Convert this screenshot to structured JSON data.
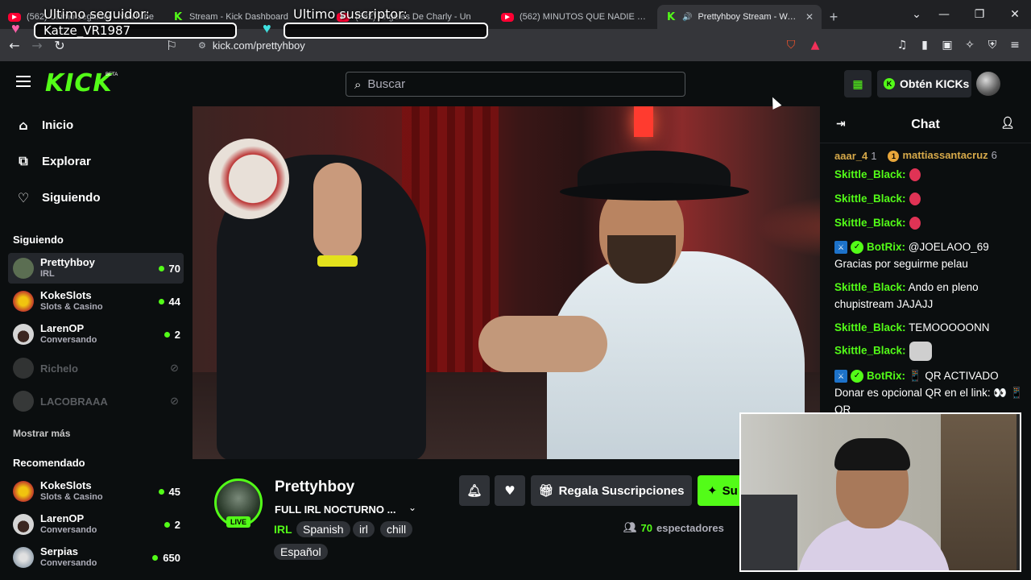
{
  "browser": {
    "tabs": [
      {
        "title": "(562) Ultimo seguidor - YouTube",
        "favicon": "youtube-icon",
        "active": false
      },
      {
        "title": "Stream - Kick Dashboard",
        "favicon": "kick-icon",
        "active": false
      },
      {
        "title": "(562) Angeles De Charly - Un",
        "favicon": "youtube-icon",
        "active": false
      },
      {
        "title": "(562) MINUTOS QUE NADIE POD",
        "favicon": "youtube-icon",
        "active": false
      },
      {
        "title": "Prettyhboy Stream - Watch",
        "favicon": "kick-icon",
        "active": true
      }
    ],
    "url": "kick.com/prettyhboy",
    "brave_badge": "10"
  },
  "overlay": {
    "follower_label": "Ultimo seguidor:",
    "follower_value": "Katze_VR1987",
    "subscriber_label": "Ultimo suscriptor:",
    "subscriber_value": ""
  },
  "header": {
    "logo": "KICK",
    "logo_badge": "BETA",
    "search_placeholder": "Buscar",
    "get_kicks": "Obtén KICKs"
  },
  "sidebar": {
    "nav": [
      {
        "label": "Inicio",
        "icon": "home-icon"
      },
      {
        "label": "Explorar",
        "icon": "compass-icon"
      },
      {
        "label": "Siguiendo",
        "icon": "heart-icon"
      }
    ],
    "following_title": "Siguiendo",
    "following": [
      {
        "name": "Prettyhboy",
        "category": "IRL",
        "viewers": "70",
        "live": true,
        "color": "#5b6e52"
      },
      {
        "name": "KokeSlots",
        "category": "Slots & Casino",
        "viewers": "44",
        "live": true,
        "color": "#c0392b"
      },
      {
        "name": "LarenOP",
        "category": "Conversando",
        "viewers": "2",
        "live": true,
        "color": "#d5d5d5"
      },
      {
        "name": "Richelo",
        "category": "",
        "viewers": "",
        "live": false,
        "color": "#777777"
      },
      {
        "name": "LACOBRAAA",
        "category": "",
        "viewers": "",
        "live": false,
        "color": "#888888"
      }
    ],
    "show_more": "Mostrar más",
    "recommended_title": "Recomendado",
    "recommended": [
      {
        "name": "KokeSlots",
        "category": "Slots & Casino",
        "viewers": "45",
        "color": "#c0392b"
      },
      {
        "name": "LarenOP",
        "category": "Conversando",
        "viewers": "2",
        "color": "#d5d5d5"
      },
      {
        "name": "Serpias",
        "category": "Conversando",
        "viewers": "650",
        "color": "#9aa7b3"
      }
    ]
  },
  "stream": {
    "streamer": "Prettyhboy",
    "title": "FULL IRL NOCTURNO ...",
    "category": "IRL",
    "tags": [
      "Spanish",
      "irl",
      "chill",
      "Español"
    ],
    "live_badge": "LIVE",
    "gift_subs": "Regala Suscripciones",
    "subscribe": "Su",
    "viewer_count": "70",
    "viewers_label": "espectadores"
  },
  "chat": {
    "title": "Chat",
    "gifters": [
      {
        "name": "aaar_4",
        "count": "1"
      },
      {
        "name": "mattiassantacruz",
        "count": "6"
      }
    ],
    "messages": [
      {
        "user": "Skittle_Black:",
        "text": "",
        "emote": "red"
      },
      {
        "user": "Skittle_Black:",
        "text": "",
        "emote": "red"
      },
      {
        "user": "Skittle_Black:",
        "text": "",
        "emote": "red"
      },
      {
        "user": "BotRix:",
        "text": "@JOELAOO_69 Gracias por seguirme pelau",
        "bot": true
      },
      {
        "user": "Skittle_Black:",
        "text": "Ando en pleno chupistream JAJAJJ"
      },
      {
        "user": "Skittle_Black:",
        "text": "TEMOOOOONN"
      },
      {
        "user": "Skittle_Black:",
        "text": "",
        "emote": "cat"
      },
      {
        "user": "BotRix:",
        "text": "📱 QR ACTIVADO Donar es opcional QR en el link: 👀 📱 QR",
        "bot": true
      }
    ]
  },
  "colors": {
    "kick_green": "#53fc18",
    "background": "#0b0e0f",
    "surface": "#2f3237"
  }
}
